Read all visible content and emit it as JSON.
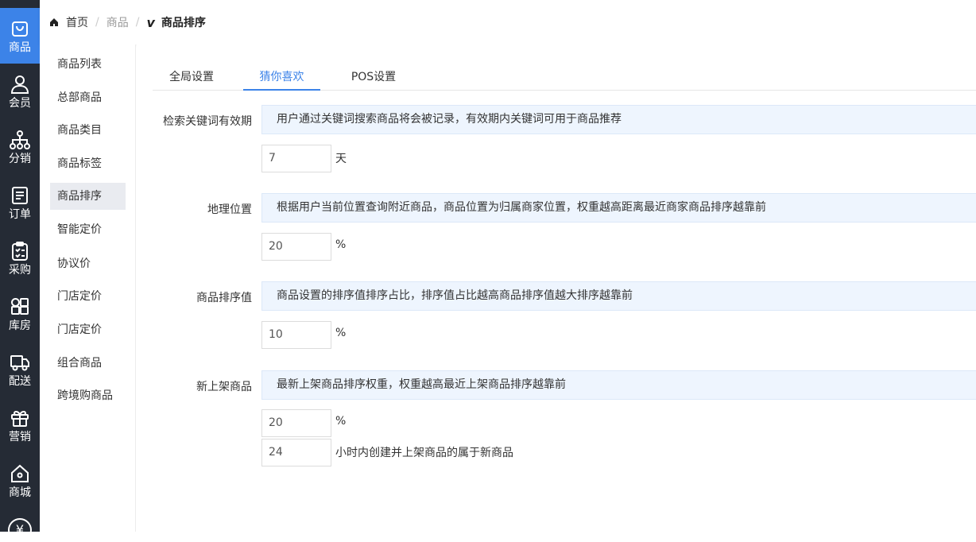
{
  "leftbar": {
    "items": [
      {
        "label": "商品",
        "icon": "shopping-bag-icon",
        "active": true
      },
      {
        "label": "会员",
        "icon": "user-icon"
      },
      {
        "label": "分销",
        "icon": "distribution-tree-icon"
      },
      {
        "label": "订单",
        "icon": "order-document-icon"
      },
      {
        "label": "采购",
        "icon": "clipboard-icon"
      },
      {
        "label": "库房",
        "icon": "warehouse-grid-icon"
      },
      {
        "label": "配送",
        "icon": "truck-icon"
      },
      {
        "label": "营销",
        "icon": "gift-icon"
      },
      {
        "label": "商城",
        "icon": "home-icon"
      }
    ],
    "accent": "#3c83e8",
    "background": "#252b35"
  },
  "breadcrumb": {
    "home": "首页",
    "level1": "商品",
    "current": "商品排序",
    "current_icon": "v"
  },
  "subnav": {
    "items": [
      "商品列表",
      "总部商品",
      "商品类目",
      "商品标签",
      "商品排序",
      "智能定价",
      "协议价",
      "门店定价",
      "门店定价",
      "组合商品",
      "跨境购商品"
    ],
    "active_index": 4
  },
  "tabs": {
    "items": [
      "全局设置",
      "猜你喜欢",
      "POS设置"
    ],
    "active_index": 1
  },
  "settings": {
    "keyword": {
      "label": "检索关键词有效期",
      "tip": "用户通过关键词搜索商品将会被记录，有效期内关键词可用于商品推荐",
      "value": "7",
      "unit": "天"
    },
    "location": {
      "label": "地理位置",
      "tip": "根据用户当前位置查询附近商品，商品位置为归属商家位置，权重越高距离最近商家商品排序越靠前",
      "value": "20",
      "unit": "%"
    },
    "sort_value": {
      "label": "商品排序值",
      "tip": "商品设置的排序值排序占比，排序值占比越高商品排序值越大排序越靠前",
      "value": "10",
      "unit": "%"
    },
    "new_listing": {
      "label": "新上架商品",
      "tip": "最新上架商品排序权重，权重越高最近上架商品排序越靠前",
      "value": "20",
      "unit": "%",
      "hours_value": "24",
      "hours_unit": "小时内创建并上架商品的属于新商品"
    }
  }
}
